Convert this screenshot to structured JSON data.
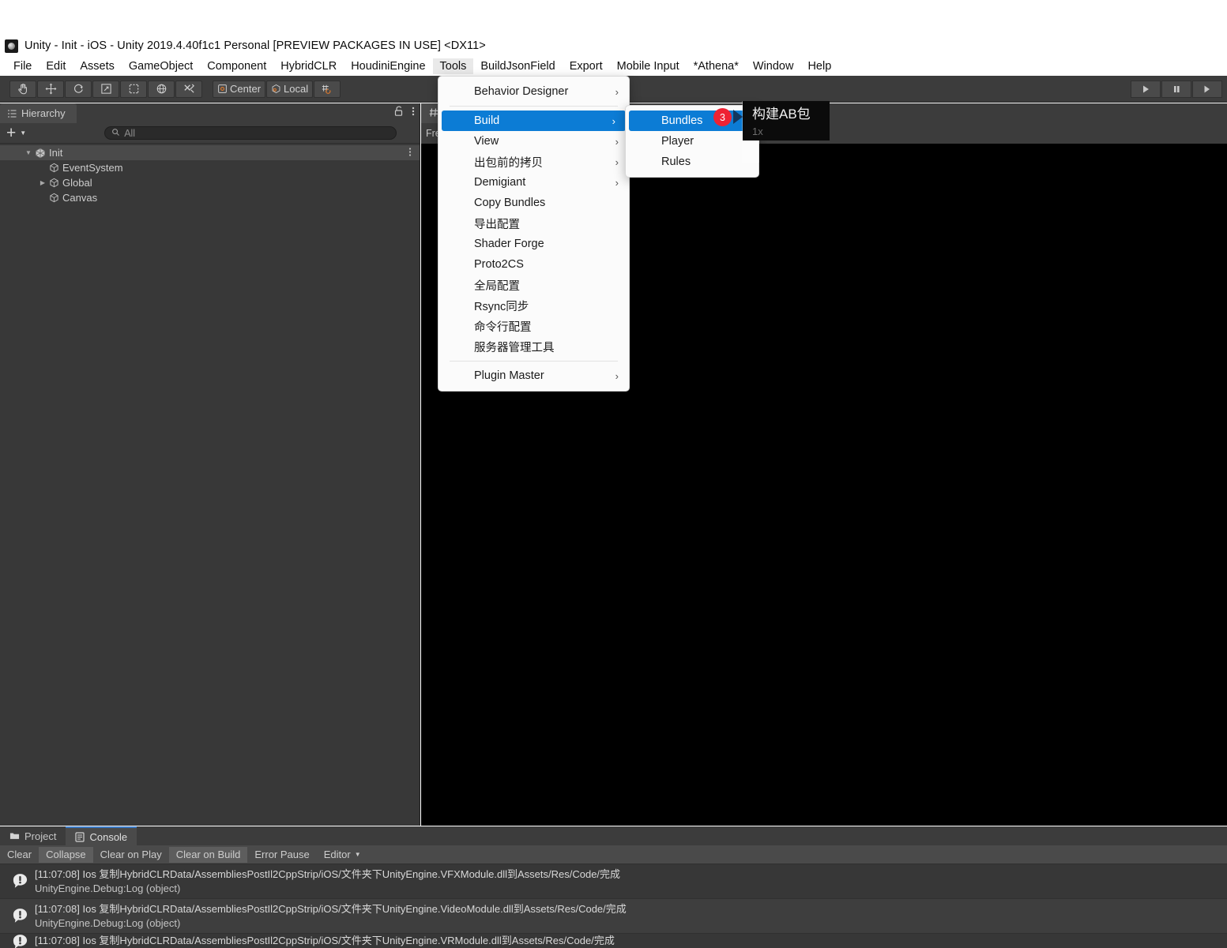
{
  "window": {
    "title": "Unity - Init - iOS - Unity 2019.4.40f1c1 Personal [PREVIEW PACKAGES IN USE] <DX11>",
    "app_icon": "unity-logo-icon"
  },
  "menubar": {
    "items": [
      {
        "label": "File",
        "active": false
      },
      {
        "label": "Edit",
        "active": false
      },
      {
        "label": "Assets",
        "active": false
      },
      {
        "label": "GameObject",
        "active": false
      },
      {
        "label": "Component",
        "active": false
      },
      {
        "label": "HybridCLR",
        "active": false
      },
      {
        "label": "HoudiniEngine",
        "active": false
      },
      {
        "label": "Tools",
        "active": true
      },
      {
        "label": "BuildJsonField",
        "active": false
      },
      {
        "label": "Export",
        "active": false
      },
      {
        "label": "Mobile Input",
        "active": false
      },
      {
        "label": "*Athena*",
        "active": false
      },
      {
        "label": "Window",
        "active": false
      },
      {
        "label": "Help",
        "active": false
      }
    ]
  },
  "toolbar": {
    "tools": [
      {
        "icon": "hand-tool-icon",
        "label": ""
      },
      {
        "icon": "move-tool-icon",
        "label": ""
      },
      {
        "icon": "rotate-tool-icon",
        "label": ""
      },
      {
        "icon": "scale-tool-icon",
        "label": ""
      },
      {
        "icon": "rect-tool-icon",
        "label": ""
      },
      {
        "icon": "transform-tool-icon",
        "label": ""
      },
      {
        "icon": "custom-tool-icon",
        "label": ""
      }
    ],
    "pivot_mode": "Center",
    "pivot_rotation": "Local",
    "snap_icon": "grid-snap-icon",
    "play_controls": [
      {
        "icon": "play-icon",
        "name": "play-button"
      },
      {
        "icon": "pause-icon",
        "name": "pause-button"
      },
      {
        "icon": "step-icon",
        "name": "step-button"
      }
    ]
  },
  "hierarchy": {
    "tab_label": "Hierarchy",
    "tab_icon": "hierarchy-icon",
    "lock_icon": "lock-icon",
    "more_icon": "kebab-menu-icon",
    "add_label": "+",
    "search": {
      "value": "",
      "placeholder": "All",
      "icon": "search-icon"
    },
    "tree": [
      {
        "name": "Init",
        "depth": 0,
        "expanded": true,
        "has_children": true,
        "selected": true,
        "icon": "scene-icon",
        "kebab": true
      },
      {
        "name": "EventSystem",
        "depth": 1,
        "expanded": false,
        "has_children": false,
        "selected": false,
        "icon": "gameobject-icon",
        "kebab": false
      },
      {
        "name": "Global",
        "depth": 1,
        "expanded": false,
        "has_children": true,
        "selected": false,
        "icon": "gameobject-icon",
        "kebab": false
      },
      {
        "name": "Canvas",
        "depth": 1,
        "expanded": false,
        "has_children": false,
        "selected": false,
        "icon": "gameobject-icon",
        "kebab": false
      }
    ]
  },
  "gameview": {
    "tab_label": "",
    "tab_icon": "game-view-icon",
    "aspect_label": "Free",
    "scale_label": "1x"
  },
  "tools_menu": {
    "items": [
      {
        "label": "Behavior Designer",
        "submenu": true,
        "highlighted": false
      },
      {
        "separator": true
      },
      {
        "label": "Build",
        "submenu": true,
        "highlighted": true
      },
      {
        "label": "View",
        "submenu": true,
        "highlighted": false
      },
      {
        "label": "出包前的拷贝",
        "submenu": true,
        "highlighted": false
      },
      {
        "label": "Demigiant",
        "submenu": true,
        "highlighted": false
      },
      {
        "label": "Copy Bundles",
        "submenu": false,
        "highlighted": false
      },
      {
        "label": "导出配置",
        "submenu": false,
        "highlighted": false
      },
      {
        "label": "Shader Forge",
        "submenu": false,
        "highlighted": false
      },
      {
        "label": "Proto2CS",
        "submenu": false,
        "highlighted": false
      },
      {
        "label": "全局配置",
        "submenu": false,
        "highlighted": false
      },
      {
        "label": "Rsync同步",
        "submenu": false,
        "highlighted": false
      },
      {
        "label": "命令行配置",
        "submenu": false,
        "highlighted": false
      },
      {
        "label": "服务器管理工具",
        "submenu": false,
        "highlighted": false
      },
      {
        "separator": true
      },
      {
        "label": "Plugin Master",
        "submenu": true,
        "highlighted": false
      }
    ]
  },
  "build_submenu": {
    "items": [
      {
        "label": "Bundles",
        "highlighted": true
      },
      {
        "label": "Player",
        "highlighted": false
      },
      {
        "label": "Rules",
        "highlighted": false
      }
    ]
  },
  "annotation": {
    "badge_number": "3",
    "tooltip_text": "构建AB包",
    "tooltip_sub": "1x"
  },
  "console": {
    "tabs": [
      {
        "label": "Project",
        "icon": "folder-icon",
        "active": false
      },
      {
        "label": "Console",
        "icon": "console-icon",
        "active": true
      }
    ],
    "buttons": [
      {
        "label": "Clear",
        "pressed": false,
        "dropdown": false
      },
      {
        "label": "Collapse",
        "pressed": true,
        "dropdown": false
      },
      {
        "label": "Clear on Play",
        "pressed": false,
        "dropdown": false
      },
      {
        "label": "Clear on Build",
        "pressed": true,
        "dropdown": false
      },
      {
        "label": "Error Pause",
        "pressed": false,
        "dropdown": false
      },
      {
        "label": "Editor",
        "pressed": false,
        "dropdown": true
      }
    ],
    "logs": [
      {
        "icon": "log-info-icon",
        "line1": "[11:07:08] Ios 复制HybridCLRData/AssembliesPostIl2CppStrip/iOS/文件夹下UnityEngine.VFXModule.dll到Assets/Res/Code/完成",
        "line2": "UnityEngine.Debug:Log (object)"
      },
      {
        "icon": "log-info-icon",
        "line1": "[11:07:08] Ios 复制HybridCLRData/AssembliesPostIl2CppStrip/iOS/文件夹下UnityEngine.VideoModule.dll到Assets/Res/Code/完成",
        "line2": "UnityEngine.Debug:Log (object)"
      },
      {
        "icon": "log-info-icon",
        "line1": "[11:07:08] Ios 复制HybridCLRData/AssembliesPostIl2CppStrip/iOS/文件夹下UnityEngine.VRModule.dll到Assets/Res/Code/完成",
        "line2": ""
      }
    ]
  },
  "colors": {
    "accent_blue": "#0c7cd5",
    "badge_red": "#ee2233",
    "panel_bg": "#383838",
    "toolbar_bg": "#3c3c3c",
    "tab_active": "#4a4a4a",
    "console_tab_accent": "#3a79c5"
  }
}
